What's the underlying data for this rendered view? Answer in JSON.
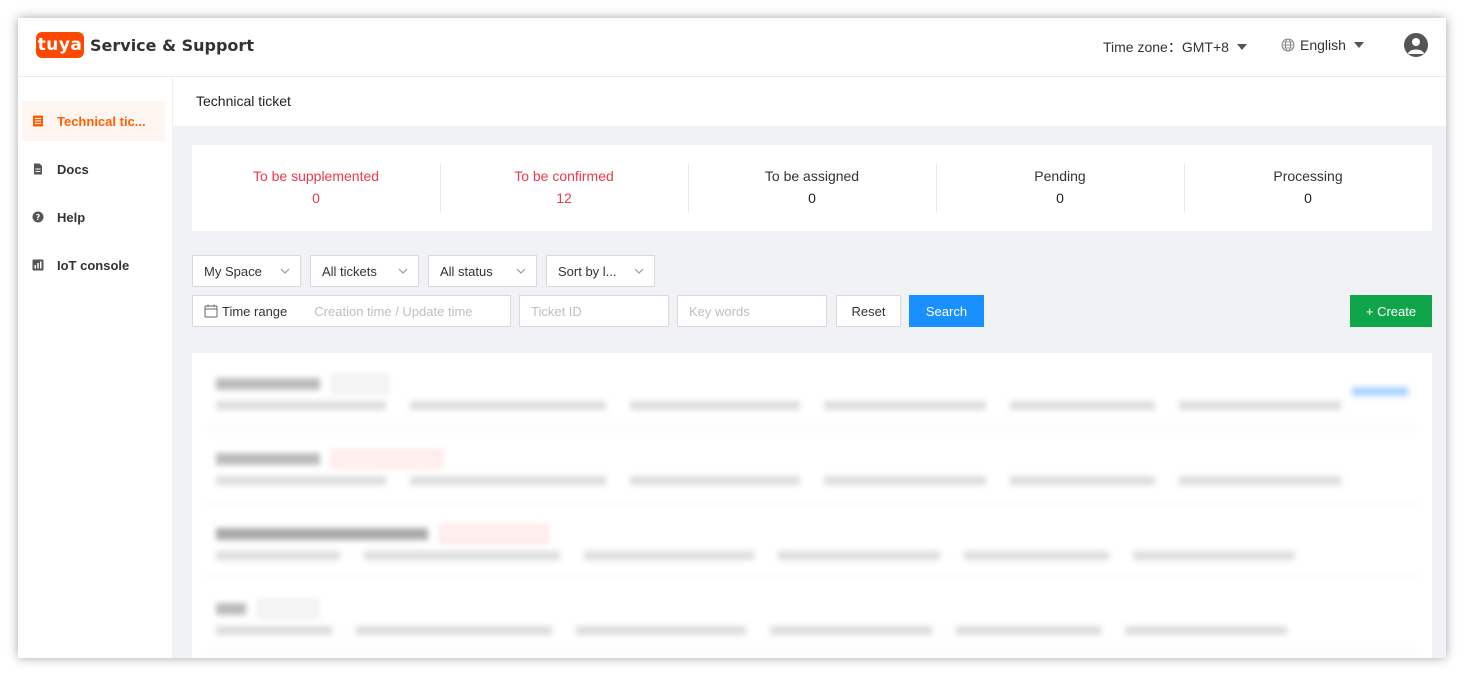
{
  "header": {
    "logo_mark": "tuya",
    "logo_text": "Service & Support",
    "timezone_label": "Time zone：GMT+8",
    "language": "English"
  },
  "sidebar": {
    "items": [
      {
        "label": "Technical tic...",
        "icon": "ticket-icon",
        "active": true
      },
      {
        "label": "Docs",
        "icon": "document-icon",
        "active": false
      },
      {
        "label": "Help",
        "icon": "help-icon",
        "active": false
      },
      {
        "label": "IoT console",
        "icon": "console-icon",
        "active": false
      }
    ]
  },
  "page": {
    "title": "Technical ticket"
  },
  "stats": [
    {
      "label": "To be supplemented",
      "value": "0"
    },
    {
      "label": "To be confirmed",
      "value": "12"
    },
    {
      "label": "To be assigned",
      "value": "0"
    },
    {
      "label": "Pending",
      "value": "0"
    },
    {
      "label": "Processing",
      "value": "0"
    }
  ],
  "filters": {
    "space": "My Space",
    "tickets": "All tickets",
    "status": "All status",
    "sort": "Sort by l..."
  },
  "search": {
    "time_range_label": "Time range",
    "time_range_placeholder": "Creation time / Update time",
    "ticket_id_placeholder": "Ticket ID",
    "keywords_placeholder": "Key words",
    "reset": "Reset",
    "search": "Search",
    "create": "+ Create"
  },
  "colors": {
    "brand": "#ff4800",
    "accent": "#ff5f00",
    "alert": "#f0384d",
    "primary": "#1890ff",
    "create": "#10a54a"
  }
}
